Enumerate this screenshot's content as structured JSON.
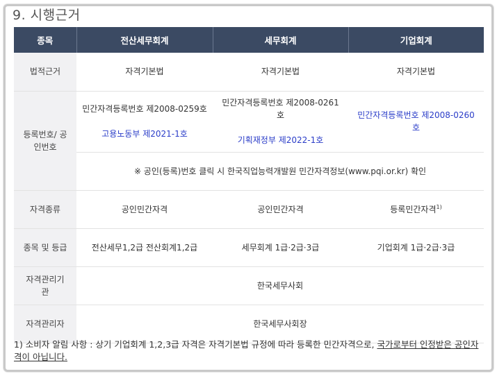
{
  "section_title": "9. 시행근거",
  "table": {
    "headers": [
      "종목",
      "전산세무회계",
      "세무회계",
      "기업회계"
    ],
    "rows": {
      "legal_basis": {
        "label": "법적근거",
        "cells": [
          "자격기본법",
          "자격기본법",
          "자격기본법"
        ]
      },
      "registration": {
        "label": "등록번호/ 공인번호",
        "computerized": {
          "reg": "민간자격등록번호 제2008-0259호",
          "cert": "고용노동부 제2021-1호"
        },
        "tax": {
          "reg": "민간자격등록번호 제2008-0261호",
          "cert": "기획재정부 제2022-1호"
        },
        "corporate": {
          "reg": "민간자격등록번호 제2008-0260호"
        },
        "notice": "※ 공인(등록)번호 클릭 시 한국직업능력개발원 민간자격정보(www.pqi.or.kr) 확인"
      },
      "qual_type": {
        "label": "자격종류",
        "cells": [
          "공인민간자격",
          "공인민간자격",
          "등록민간자격"
        ],
        "footnote_mark": "1)"
      },
      "grades": {
        "label": "종목 및 등급",
        "cells": [
          "전산세무1,2급 전산회계1,2급",
          "세무회계 1급·2급·3급",
          "기업회계 1급·2급·3급"
        ]
      },
      "manager": {
        "label": "자격관리기관",
        "value": "한국세무사회"
      },
      "administrator": {
        "label": "자격관리자",
        "value": "한국세무사회장"
      }
    }
  },
  "footnote": {
    "text": "1) 소비자 알림 사항 : 상기 기업회계 1,2,3급 자격은 자격기본법 규정에 따라 등록한 민간자격으로, ",
    "underlined": "국가로부터 인정받은 공인자격이 아닙니다."
  }
}
